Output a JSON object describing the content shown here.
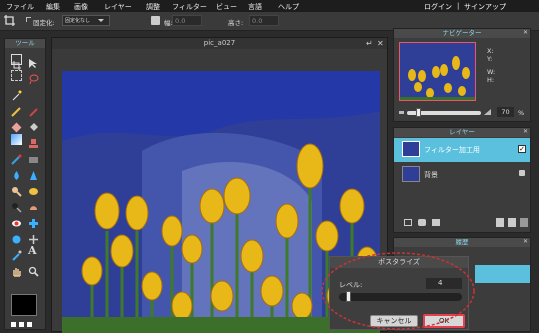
{
  "menubar": {
    "items": [
      "ファイル",
      "編集",
      "画像",
      "レイヤー",
      "調整",
      "フィルター",
      "ビュー",
      "言語",
      "ヘルプ"
    ],
    "login": "ログイン",
    "separator": "|",
    "signup": "サインアップ"
  },
  "options": {
    "fixed_label": "固定化:",
    "fixed_value": "固定化なし",
    "width_label": "幅:",
    "width_value": "0.0",
    "height_label": "高さ:",
    "height_value": "0.0"
  },
  "toolbox": {
    "title": "ツール"
  },
  "document": {
    "title": "pic_a027"
  },
  "navigator": {
    "title": "ナビゲーター",
    "x_label": "X:",
    "y_label": "Y:",
    "w_label": "W:",
    "h_label": "H:",
    "zoom": "70",
    "zoom_unit": "%"
  },
  "layers": {
    "title": "レイヤー",
    "items": [
      {
        "name": "フィルター加工用",
        "selected": true
      },
      {
        "name": "背景",
        "selected": false
      }
    ]
  },
  "history": {
    "title": "履歴"
  },
  "dialog": {
    "title": "ポスタライズ",
    "level_label": "レベル:",
    "level_value": "4",
    "level_fraction": 0.05,
    "cancel_label": "キャンセル",
    "ok_label": "OK"
  },
  "colors": {
    "accent": "#5bc0de",
    "ok_border": "#e2404e",
    "highlight": "#cc3333",
    "sky": "#2e3f9a",
    "tulip": "#e8b818"
  }
}
